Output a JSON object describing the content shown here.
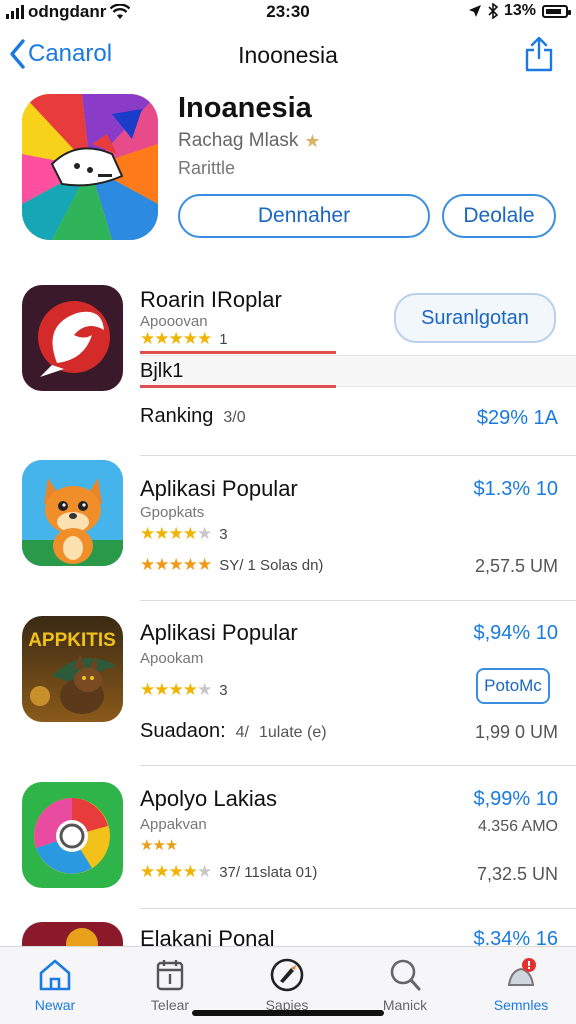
{
  "status": {
    "carrier": "odngdanr",
    "time": "23:30",
    "battery": "13%"
  },
  "nav": {
    "back_label": "Canarol",
    "title": "Inoonesia"
  },
  "hero": {
    "title": "Inoanesia",
    "subtitle": "Rachag Mlask",
    "category": "Rarittle",
    "button_primary": "Dennaher",
    "button_secondary": "Deolale"
  },
  "rows": [
    {
      "name": "Roarin IRoplar",
      "sub": "Apooovan",
      "stars": "★★★★★",
      "count": "1",
      "action": "Suranlgotan",
      "highlight": "Bjlk1",
      "ranking_label": "Ranking",
      "ranking_value": "3/0",
      "price": "$29% 1A"
    },
    {
      "name": "Aplikasi Popular",
      "sub": "Gpopkats",
      "stars": "★★★★",
      "stars_dim": "★",
      "count": "3",
      "meta_stars": "★★★★★",
      "meta_text": "SY/ 1 Solas dn)",
      "price": "$1.3% 10",
      "size": "2,57.5 UM"
    },
    {
      "name": "Aplikasi Popular",
      "sub": "Apookam",
      "stars": "★★★★",
      "stars_dim": "★",
      "count": "3",
      "meta_label": "Suadaon:",
      "meta_num": "4/",
      "meta_text": "1ulate (e)",
      "price": "$,94% 10",
      "badge": "PotoMc",
      "size": "1,99 0 UM",
      "icon_text": "APPKITIS"
    },
    {
      "name": "Apolyo Lakias",
      "sub": "Appakvan",
      "stars": "★★★",
      "meta_stars": "★★★★",
      "meta_stars_dim": "★",
      "meta_text": "37/ 11slata 01)",
      "price": "$,99% 10",
      "price2": "4.356 AMO",
      "size": "7,32.5 UN"
    },
    {
      "name": "Elakani Ponal",
      "price": "$.34% 16"
    }
  ],
  "tabs": [
    {
      "label": "Newar",
      "icon": "house-icon"
    },
    {
      "label": "Telear",
      "icon": "calendar-icon"
    },
    {
      "label": "Sapies",
      "icon": "rocket-icon"
    },
    {
      "label": "Manick",
      "icon": "search-icon"
    },
    {
      "label": "Semnles",
      "icon": "notification-icon"
    }
  ],
  "colors": {
    "accent": "#1a7ae0",
    "star": "#f0b400",
    "highlight_red": "#e05050"
  }
}
